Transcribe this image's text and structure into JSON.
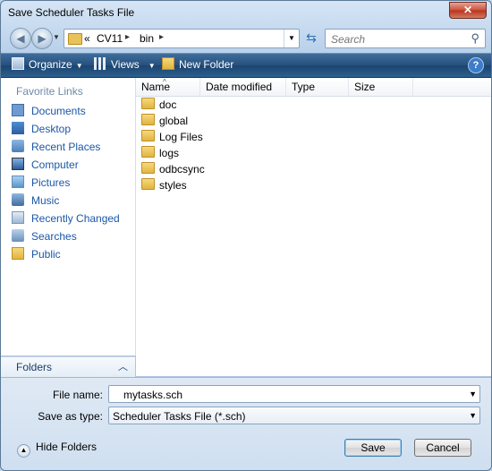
{
  "window": {
    "title": "Save Scheduler Tasks File"
  },
  "address": {
    "prefix": "«",
    "segments": [
      "CV11",
      "bin"
    ]
  },
  "search": {
    "placeholder": "Search"
  },
  "toolbar": {
    "organize": "Organize",
    "views": "Views",
    "new_folder": "New Folder"
  },
  "favorites": {
    "header": "Favorite Links",
    "items": [
      {
        "label": "Documents",
        "icon": "documents-icon"
      },
      {
        "label": "Desktop",
        "icon": "desktop-icon"
      },
      {
        "label": "Recent Places",
        "icon": "recent-places-icon"
      },
      {
        "label": "Computer",
        "icon": "computer-icon"
      },
      {
        "label": "Pictures",
        "icon": "pictures-icon"
      },
      {
        "label": "Music",
        "icon": "music-icon"
      },
      {
        "label": "Recently Changed",
        "icon": "recently-changed-icon"
      },
      {
        "label": "Searches",
        "icon": "searches-icon"
      },
      {
        "label": "Public",
        "icon": "public-icon"
      }
    ]
  },
  "folders_bar": {
    "label": "Folders"
  },
  "columns": [
    "Name",
    "Date modified",
    "Type",
    "Size"
  ],
  "files": [
    "doc",
    "global",
    "Log Files",
    "logs",
    "odbcsync",
    "styles"
  ],
  "form": {
    "file_name_label": "File name:",
    "file_name_value": "mytasks.sch",
    "type_label": "Save as type:",
    "type_value": "Scheduler Tasks File (*.sch)"
  },
  "footer": {
    "hide_folders": "Hide Folders",
    "save": "Save",
    "cancel": "Cancel"
  }
}
